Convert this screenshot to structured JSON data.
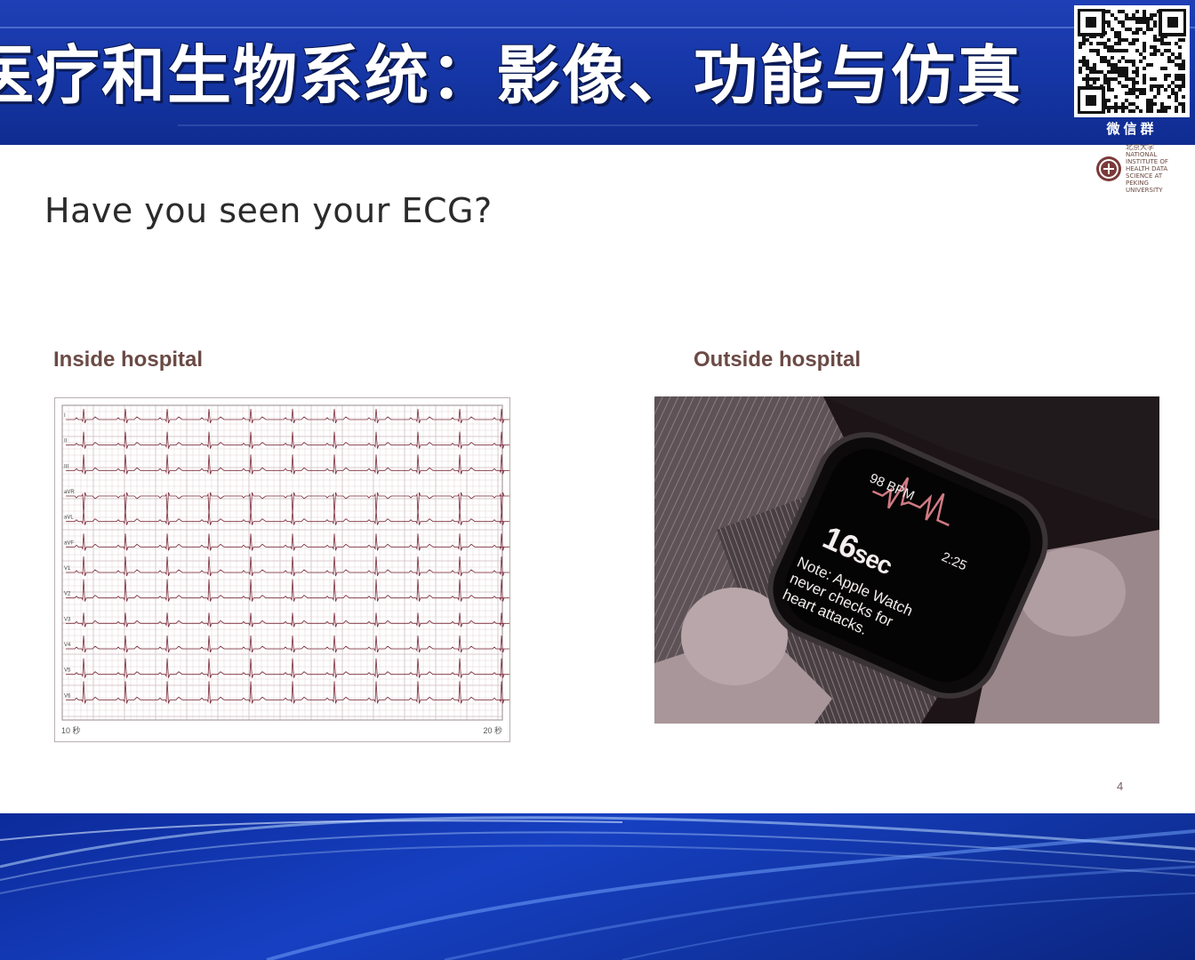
{
  "banner": {
    "title": "医疗和生物系统：影像、功能与仿真",
    "qr_caption": "微信群",
    "qr_icon": "qr-code-icon"
  },
  "logo": {
    "icon": "university-seal-icon",
    "name_cn": "北京大学",
    "name_en": "NATIONAL INSTITUTE OF HEALTH DATA SCIENCE AT PEKING UNIVERSITY"
  },
  "slide": {
    "title": "Have you seen your ECG?",
    "page_number": "4"
  },
  "inside": {
    "label": "Inside hospital",
    "ecg_start": "10 秒",
    "ecg_end": "20 秒",
    "leads": [
      "I",
      "II",
      "III",
      "aVR",
      "aVL",
      "aVF",
      "V1",
      "V2",
      "V3",
      "V4",
      "V5",
      "V6"
    ]
  },
  "outside": {
    "label": "Outside hospital",
    "watch_bpm": "98 BPM",
    "watch_time": "2:25",
    "watch_seconds": "16",
    "watch_seconds_unit": "sec",
    "watch_note": "Note: Apple Watch never checks for heart attacks."
  },
  "colors": {
    "banner_blue": "#1637a8",
    "label_brown": "#6b4a45",
    "ecg_trace": "#7a2a3a",
    "ecg_grid": "#d9c9cc"
  }
}
